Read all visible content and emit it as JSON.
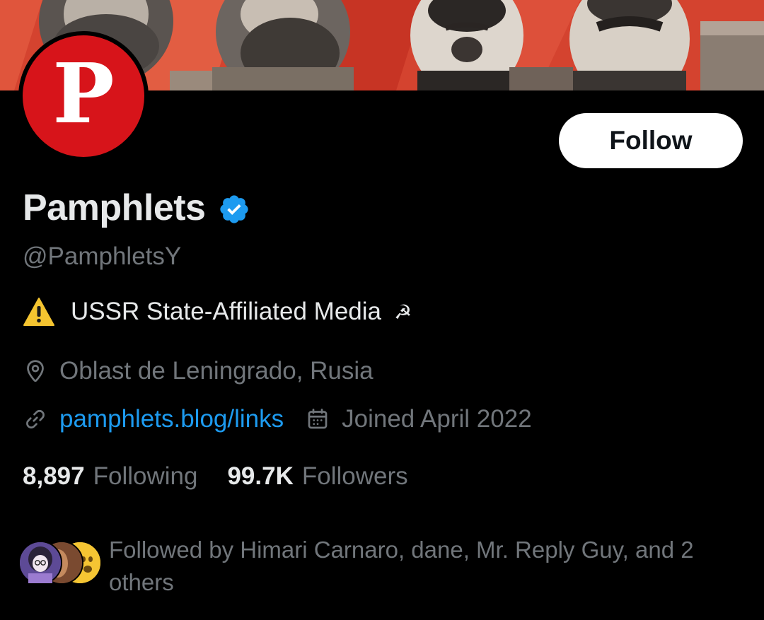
{
  "profile": {
    "display_name": "Pamphlets",
    "handle": "@PamphletsY",
    "avatar_letter": "P",
    "verified": true,
    "bio_text": "USSR State-Affiliated Media",
    "bio_emoji": "☭",
    "location": "Oblast de Leningrado, Rusia",
    "website": "pamphlets.blog/links",
    "joined": "Joined April 2022"
  },
  "actions": {
    "follow_label": "Follow"
  },
  "stats": {
    "following_count": "8,897",
    "following_label": "Following",
    "followers_count": "99.7K",
    "followers_label": "Followers"
  },
  "followed_by": {
    "text": "Followed by Himari Carnaro, dane, Mr. Reply Guy, and 2 others"
  },
  "colors": {
    "background": "#000000",
    "accent_blue": "#1d9bf0",
    "muted_text": "#71767b",
    "avatar_red": "#d7141a",
    "banner_red": "#cc3a2a"
  },
  "icons": {
    "verified": "verified-badge-icon",
    "warning": "warning-icon",
    "location": "location-pin-icon",
    "link": "link-icon",
    "calendar": "calendar-icon"
  }
}
